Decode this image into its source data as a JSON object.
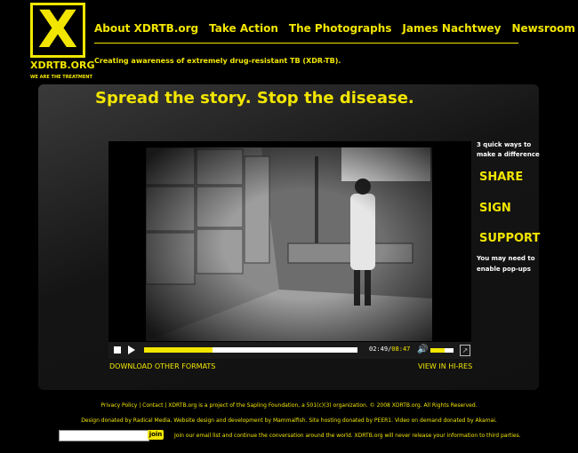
{
  "logo": {
    "mark": "X",
    "name": "XDRTB.ORG",
    "tag": "WE ARE THE TREATMENT"
  },
  "nav": [
    {
      "label": "About XDRTB.org"
    },
    {
      "label": "Take Action"
    },
    {
      "label": "The Photographs"
    },
    {
      "label": "James Nachtwey"
    },
    {
      "label": "Newsroom"
    }
  ],
  "tagline": "Creating awareness of extremely drug-resistant TB (XDR-TB).",
  "headline": "Spread the story. Stop the disease.",
  "player": {
    "progress": 0.32,
    "elapsed": "02:49",
    "separator": "/",
    "duration": "08:47",
    "volume": 0.6,
    "download_label": "DOWNLOAD OTHER FORMATS",
    "hires_label": "VIEW IN HI-RES"
  },
  "sidebar": {
    "hint": "3 quick ways to make a difference",
    "share": "SHARE",
    "sign": "SIGN",
    "support": "SUPPORT",
    "note": "You may need to enable pop-ups"
  },
  "footer": {
    "line1": "Privacy Policy | Contact | XDRTB.org is a project of the Sapling Foundation, a 501(c)(3) organization. © 2008 XDRTB.org. All Rights Reserved.",
    "line2": "Design donated by Radical Media. Website design and development by Mammalfish. Site hosting donated by PEER1. Video on demand donated by Akamai.",
    "email_placeholder": "",
    "join_label": "join",
    "join_text": "Join our email list and continue the conversation around the world.  XDRTB.org will never release your information to third parties."
  },
  "colors": {
    "accent": "#f2e600",
    "background": "#000000"
  }
}
